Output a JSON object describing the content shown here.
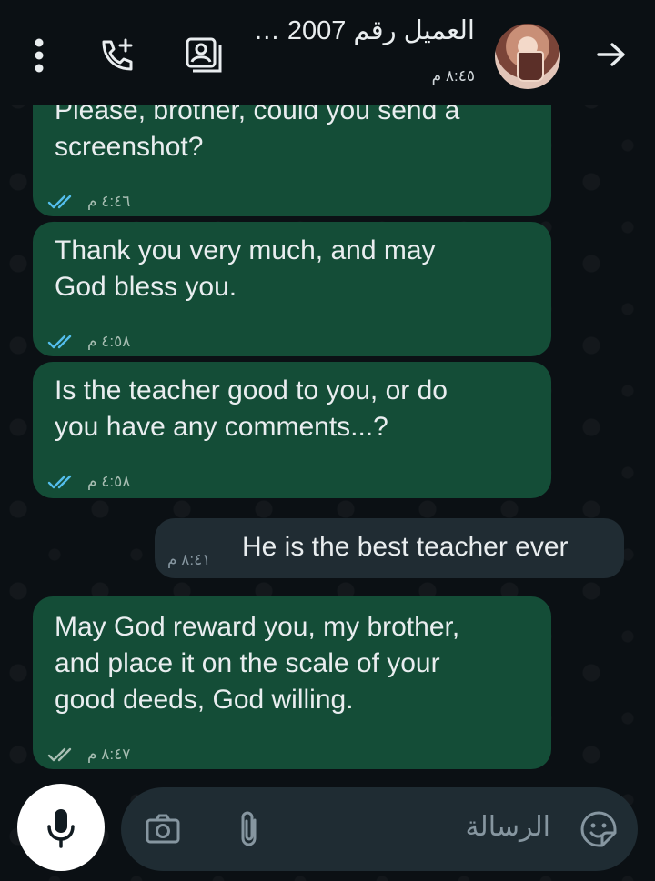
{
  "header": {
    "contact_name": "العميل رقم 2007 …",
    "last_seen": "٨:٤٥ م",
    "icons": {
      "back": "arrow-right-icon",
      "contact": "contact-card-icon",
      "call": "add-call-icon",
      "menu": "more-vertical-icon"
    }
  },
  "messages": [
    {
      "direction": "outgoing",
      "text": "Please, brother, could you send a screenshot?",
      "line1": "Please, brother, could you send a",
      "line2": "screenshot?",
      "time": "٤:٤٦ م",
      "status": "read"
    },
    {
      "direction": "outgoing",
      "text": "Thank you very much, and may God bless you.",
      "line1": "Thank you very much, and may",
      "line2": "God bless you.",
      "time": "٤:٥٨ م",
      "status": "read"
    },
    {
      "direction": "outgoing",
      "text": "Is the teacher good to you, or do you have any comments...?",
      "line1": "Is the teacher good to you, or do",
      "line2": "you have any comments...?",
      "time": "٤:٥٨ م",
      "status": "read"
    },
    {
      "direction": "incoming",
      "text": "He is the best teacher ever",
      "time": "٨:٤١ م"
    },
    {
      "direction": "outgoing",
      "text": "May God reward you, my brother, and place it on the scale of your good deeds, God willing.",
      "line1": "May God reward you, my brother,",
      "line2": "and place it on the scale of your",
      "line3": "good deeds, God willing.",
      "time": "٨:٤٧ م",
      "status": "delivered"
    }
  ],
  "composer": {
    "placeholder": "الرسالة",
    "icons": {
      "mic": "microphone-icon",
      "camera": "camera-icon",
      "attach": "paperclip-icon",
      "emoji": "sticker-emoji-icon"
    }
  },
  "colors": {
    "background": "#0b1014",
    "outgoing_bubble": "#144d37",
    "incoming_bubble": "#202c33",
    "read_ticks": "#53bdeb",
    "delivered_ticks": "#a7bdb2",
    "input_bar": "#1f2c33"
  }
}
